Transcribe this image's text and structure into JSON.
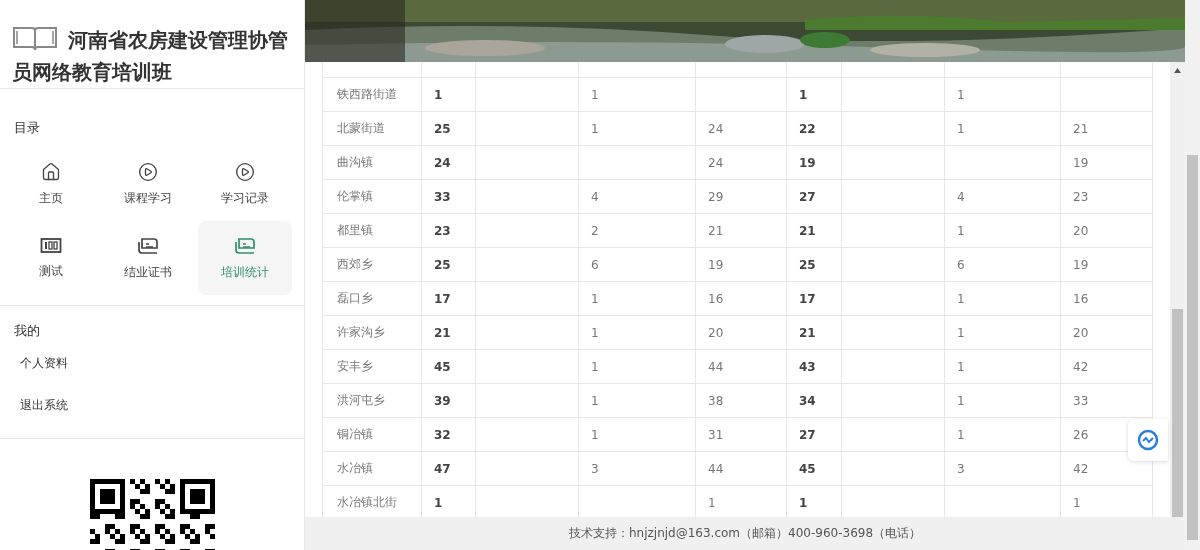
{
  "sidebar": {
    "title": "河南省农房建设管理协管员网络教育培训班",
    "menu_heading": "目录",
    "menu": [
      {
        "label": "主页",
        "selected": false
      },
      {
        "label": "课程学习",
        "selected": false
      },
      {
        "label": "学习记录",
        "selected": false
      },
      {
        "label": "测试",
        "selected": false
      },
      {
        "label": "结业证书",
        "selected": false
      },
      {
        "label": "培训统计",
        "selected": true
      }
    ],
    "mine_heading": "我的",
    "mine": [
      "个人资料",
      "退出系统"
    ]
  },
  "table": {
    "rows": [
      [
        "铁西路街道",
        "1",
        "",
        "1",
        "",
        "1",
        "",
        "1",
        ""
      ],
      [
        "北蒙街道",
        "25",
        "",
        "1",
        "24",
        "22",
        "",
        "1",
        "21"
      ],
      [
        "曲沟镇",
        "24",
        "",
        "",
        "24",
        "19",
        "",
        "",
        "19"
      ],
      [
        "伦掌镇",
        "33",
        "",
        "4",
        "29",
        "27",
        "",
        "4",
        "23"
      ],
      [
        "都里镇",
        "23",
        "",
        "2",
        "21",
        "21",
        "",
        "1",
        "20"
      ],
      [
        "西郊乡",
        "25",
        "",
        "6",
        "19",
        "25",
        "",
        "6",
        "19"
      ],
      [
        "磊口乡",
        "17",
        "",
        "1",
        "16",
        "17",
        "",
        "1",
        "16"
      ],
      [
        "许家沟乡",
        "21",
        "",
        "1",
        "20",
        "21",
        "",
        "1",
        "20"
      ],
      [
        "安丰乡",
        "45",
        "",
        "1",
        "44",
        "43",
        "",
        "1",
        "42"
      ],
      [
        "洪河屯乡",
        "39",
        "",
        "1",
        "38",
        "34",
        "",
        "1",
        "33"
      ],
      [
        "铜冶镇",
        "32",
        "",
        "1",
        "31",
        "27",
        "",
        "1",
        "26"
      ],
      [
        "水冶镇",
        "47",
        "",
        "3",
        "44",
        "45",
        "",
        "3",
        "42"
      ],
      [
        "水冶镇北街",
        "1",
        "",
        "",
        "1",
        "1",
        "",
        "",
        "1"
      ]
    ]
  },
  "footer": "技术支持：hnjzjnjd@163.com（邮箱）400-960-3698（电话）"
}
